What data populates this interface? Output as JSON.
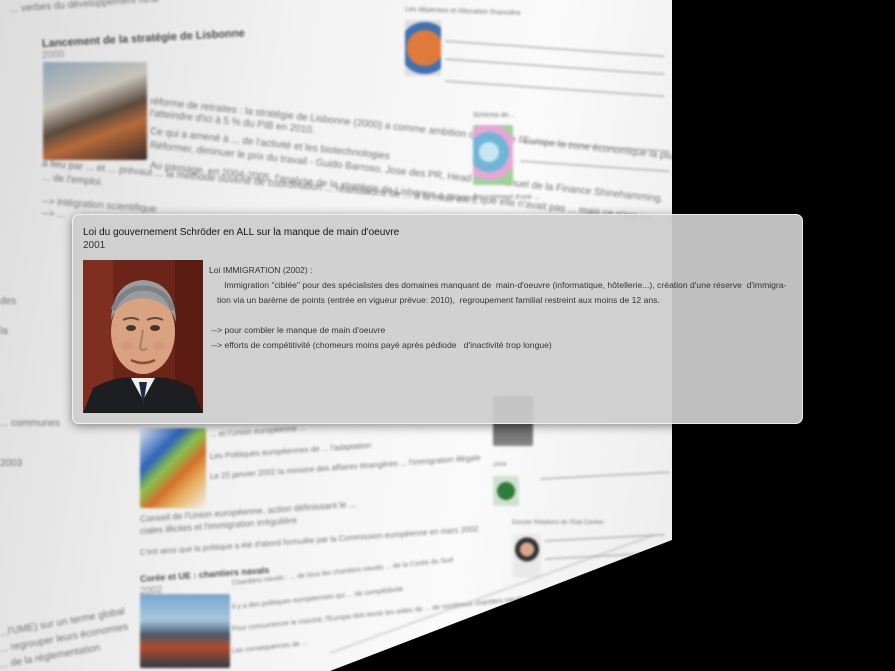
{
  "background_page": {
    "header_fragment": "... verbes du développement rural",
    "event_1": {
      "title": "Lancement de la stratégie de Lisbonne",
      "year": "2000",
      "paragraphs": [
        "réforme de retraites : la stratégie de Lisbonne (2000) a comme ambition de faire de l'Europe la zone économique la plus compétitive ... de la connaissance",
        "l'atteindre d'ici à 5 % du PIB en 2010.",
        "Ce qui a amené à ... de l'activité et les biotechnologies",
        "Réformer, diminuer le prix du travail - Guido Barroso, Jose des PR, Head d'Emmanuel de la Finance Shinehamming.",
        "Au passage, en 2004-2005, l'analyse de la stratégie de Lisbonne a montré que elle n'avait pas ... mais ce n'est sur ... la politique européenne",
        "a lieu par ... et ... prévaut ... la méthode ouverte de coordination ... réalisations de ... à la mise en ...",
        "... de l'emploi."
      ],
      "links": [
        "--> intégration scientifique",
        "--> ..."
      ]
    },
    "right_column": {
      "pie_caption": "Les dépenses et Allocation financière",
      "map_caption": "Schéma de...",
      "map_caption_2": "Recrutement d'une ..."
    },
    "event_2": {
      "title": "Conseil de l'Union européenne, action définissant le Pacte européen sur l'immigration et l'asile",
      "paragraphs": [
        "... et l'Union européenne ...",
        "Les Politiques européennes de ... l'adaptation",
        "Le 25 janvier 2002 la ministre des affaires étrangères ... l'immigration illégale",
        "Conseil de l'Union européenne, action définissant le ...",
        "ciales illicites et l'immigration irrégulière",
        "C'est ainsi que la politique a été d'abord formulée par la Commission européenne en mars 2002"
      ]
    },
    "event_3": {
      "title": "Corée et UE : chantiers navals",
      "year": "2002",
      "paragraphs": [
        "Chantiers navals : ... de tous les chantiers navals ... de la Corée du Sud",
        "Il y a des politiques européennes qui ... de compétitivité",
        "Pour concurrencer le marché, l'Europe doit revoir les aides de ... de nombreux chantiers navals ...",
        "Les conséquences de ..."
      ]
    },
    "left_fragments": [
      "des",
      "la",
      "... communes",
      "2003",
      "...l'UME) sur un terme global",
      "... regrouper leurs économies",
      "... de la réglementation"
    ],
    "right_bottom": {
      "caption_1": "2004",
      "caption_2": "Dossier Relations de l'État Coréen"
    }
  },
  "popup": {
    "title": "Loi du gouvernement Schröder en ALL sur la manque de main d'oeuvre",
    "year": "2001",
    "lines": [
      "Loi IMMIGRATION (2002) :",
      "   Immigration \"ciblée\" pour des spécialistes des domaines manquant de  main-d'oeuvre (informatique, hôtellerie...), création d'une réserve  d'immigra-",
      "tion via un barème de points (entrée en vigueur prévue: 2010),  regroupement familial restreint aux moins de 12 ans.",
      "",
      " --> pour combler le manque de main d'oeuvre",
      " --> efforts de compétitivité (chomeurs moins payé après pédiode   d'inactivité trop longue)"
    ],
    "portrait_icon": "portrait-photo"
  }
}
